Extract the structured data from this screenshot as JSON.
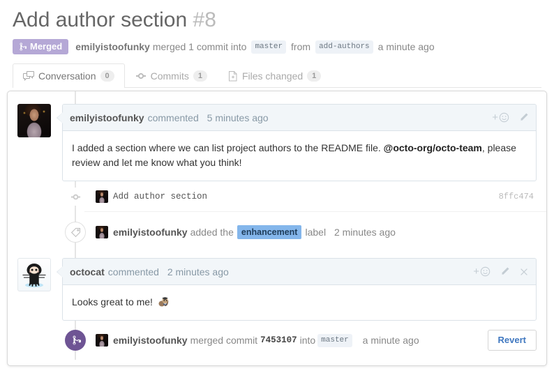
{
  "pull_request": {
    "title": "Add author section",
    "number": "#8",
    "state_label": "Merged",
    "state_icon": "git-merge-icon",
    "state_color": "#b5a8d6",
    "meta": {
      "actor": "emilyistoofunky",
      "action_text": "merged 1 commit into",
      "base_branch": "master",
      "from_text": "from",
      "head_branch": "add-authors",
      "time": "a minute ago"
    }
  },
  "tabs": [
    {
      "label": "Conversation",
      "count": "0",
      "icon": "comment-discussion-icon",
      "active": true
    },
    {
      "label": "Commits",
      "count": "1",
      "icon": "git-commit-icon",
      "active": false
    },
    {
      "label": "Files changed",
      "count": "1",
      "icon": "diff-file-icon",
      "active": false
    }
  ],
  "timeline": {
    "comment_1": {
      "author": "emilyistoofunky",
      "action": "commented",
      "time": "5 minutes ago",
      "body_part1": "I added a section where we can list project authors to the README file. ",
      "body_mention": "@octo-org/octo-team",
      "body_part2": ", please review and let me know what you think!",
      "actions": [
        "add-reaction",
        "edit"
      ]
    },
    "commit": {
      "message": "Add author section",
      "sha": "8ffc474"
    },
    "label_event": {
      "actor": "emilyistoofunky",
      "action": "added the",
      "label": "enhancement",
      "label_color": "#84b6eb",
      "suffix": "label",
      "time": "2 minutes ago"
    },
    "comment_2": {
      "author": "octocat",
      "action": "commented",
      "time": "2 minutes ago",
      "body": "Looks great to me!",
      "emoji": "shipit-squirrel",
      "actions": [
        "add-reaction",
        "edit",
        "close"
      ]
    },
    "merge_event": {
      "actor": "emilyistoofunky",
      "action": "merged commit",
      "sha": "7453107",
      "into_text": "into",
      "branch": "master",
      "time": "a minute ago",
      "button": "Revert",
      "button_color": "#4078c0"
    }
  }
}
